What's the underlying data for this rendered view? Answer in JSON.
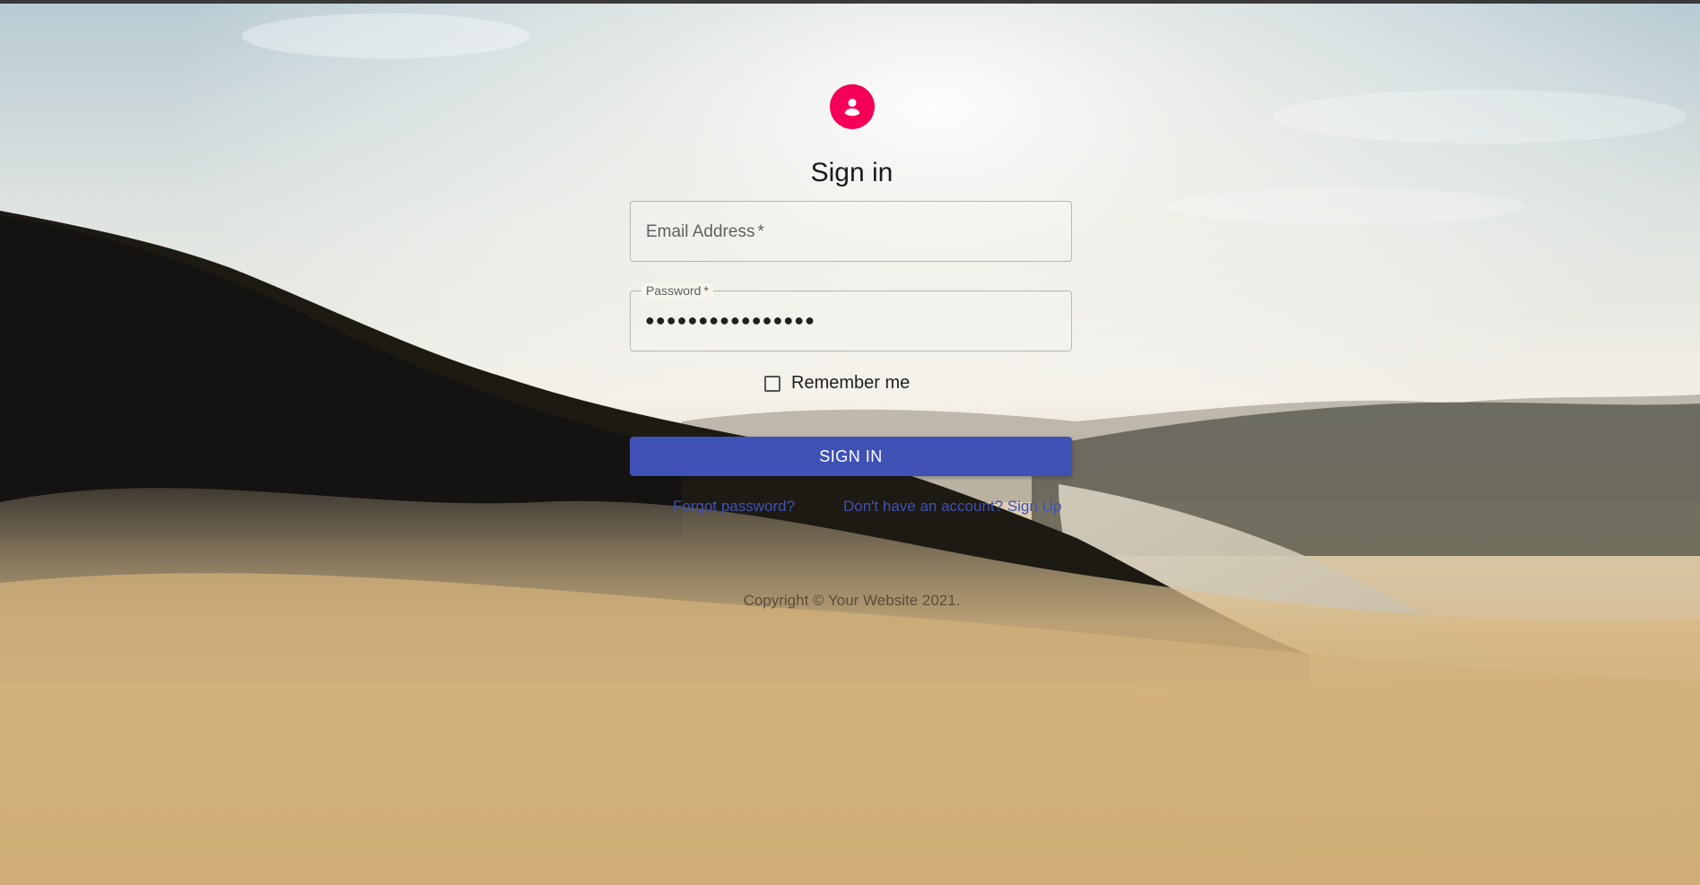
{
  "page": {
    "title": "Sign in",
    "avatar_icon": "person-icon",
    "accent_color": "#f50057",
    "primary_color": "#3f51b5"
  },
  "form": {
    "email": {
      "label": "Email Address",
      "required_mark": "*",
      "value": ""
    },
    "password": {
      "label": "Password",
      "required_mark": "*",
      "masked_value": "●●●●●●●●●●●●●●●●"
    },
    "remember": {
      "label": "Remember me",
      "checked": false
    },
    "submit_label": "SIGN IN"
  },
  "links": {
    "forgot": "Forgot password?",
    "signup": "Don't have an account? Sign Up"
  },
  "footer": {
    "copyright": "Copyright © Your Website 2021."
  }
}
